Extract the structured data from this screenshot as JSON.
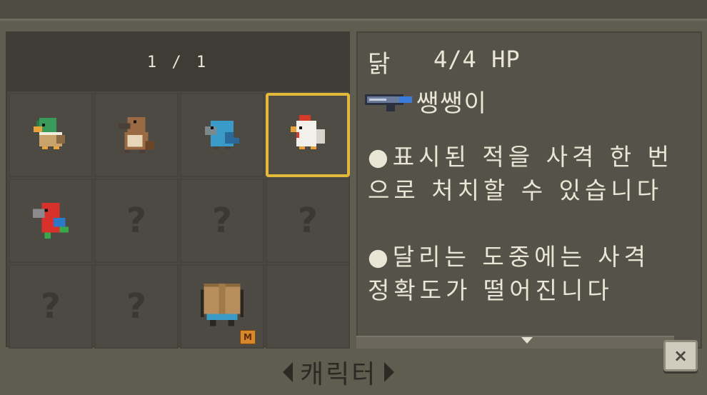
{
  "page_indicator": "1 / 1",
  "characters": [
    {
      "id": "duck",
      "label": "",
      "icon": "duck-icon",
      "locked": false,
      "selected": false
    },
    {
      "id": "platypus",
      "label": "",
      "icon": "platypus-icon",
      "locked": false,
      "selected": false
    },
    {
      "id": "bluebird",
      "label": "",
      "icon": "blue-bird-icon",
      "locked": false,
      "selected": false
    },
    {
      "id": "chicken",
      "label": "",
      "icon": "chicken-icon",
      "locked": false,
      "selected": true
    },
    {
      "id": "parrot",
      "label": "",
      "icon": "parrot-icon",
      "locked": false,
      "selected": false
    },
    {
      "id": "locked1",
      "label": "?",
      "icon": "question-mark-icon",
      "locked": true
    },
    {
      "id": "locked2",
      "label": "?",
      "icon": "question-mark-icon",
      "locked": true
    },
    {
      "id": "locked3",
      "label": "?",
      "icon": "question-mark-icon",
      "locked": true
    },
    {
      "id": "locked4",
      "label": "?",
      "icon": "question-mark-icon",
      "locked": true
    },
    {
      "id": "locked5",
      "label": "?",
      "icon": "question-mark-icon",
      "locked": true
    },
    {
      "id": "boxman",
      "label": "",
      "icon": "cardboard-box-character-icon",
      "locked": false,
      "badge": "M"
    }
  ],
  "info": {
    "name": "닭",
    "hp": "4/4 HP",
    "weapon_icon": "gun-icon",
    "weapon_name": "쌩쌩이",
    "desc1": "●표시된 적을 사격 한 번으로 처치할 수 있습니다",
    "desc2": "●달리는 도중에는 사격 정확도가 떨어진니다"
  },
  "nav": {
    "title": "캐릭터"
  },
  "close_label": "×",
  "colors": {
    "selected_border": "#e2b93a",
    "badge": "#d9872b"
  }
}
